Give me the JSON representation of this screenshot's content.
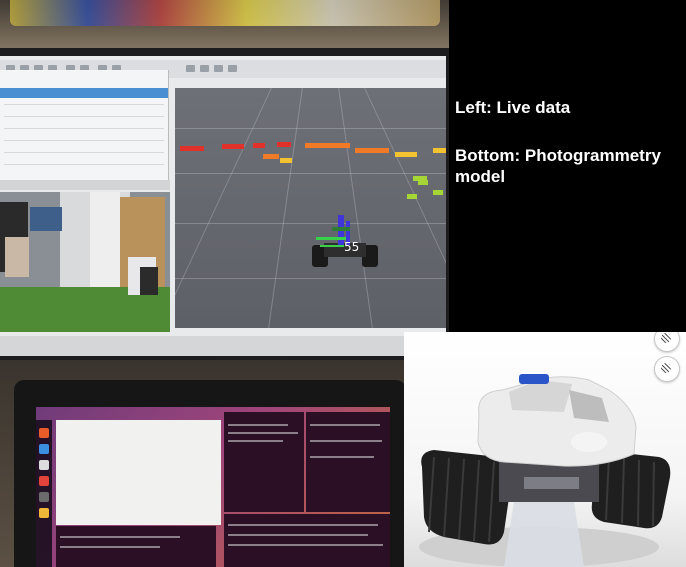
{
  "annotation": {
    "live_label": "Left: Live data",
    "model_label": "Bottom: Photogrammetry model"
  },
  "rviz": {
    "marker_label": "55"
  },
  "colors": {
    "panel_bg": "#000000",
    "panel_text": "#ffffff",
    "voxel_red": "#e0322a",
    "voxel_orange": "#f07a26",
    "voxel_yellow": "#f2c230",
    "voxel_green": "#a6d635",
    "robot_marker_blue": "#3f35d8",
    "robot_marker_green": "#38d24a"
  },
  "icons": [
    "orbit-control-icon",
    "rotate-control-icon"
  ]
}
